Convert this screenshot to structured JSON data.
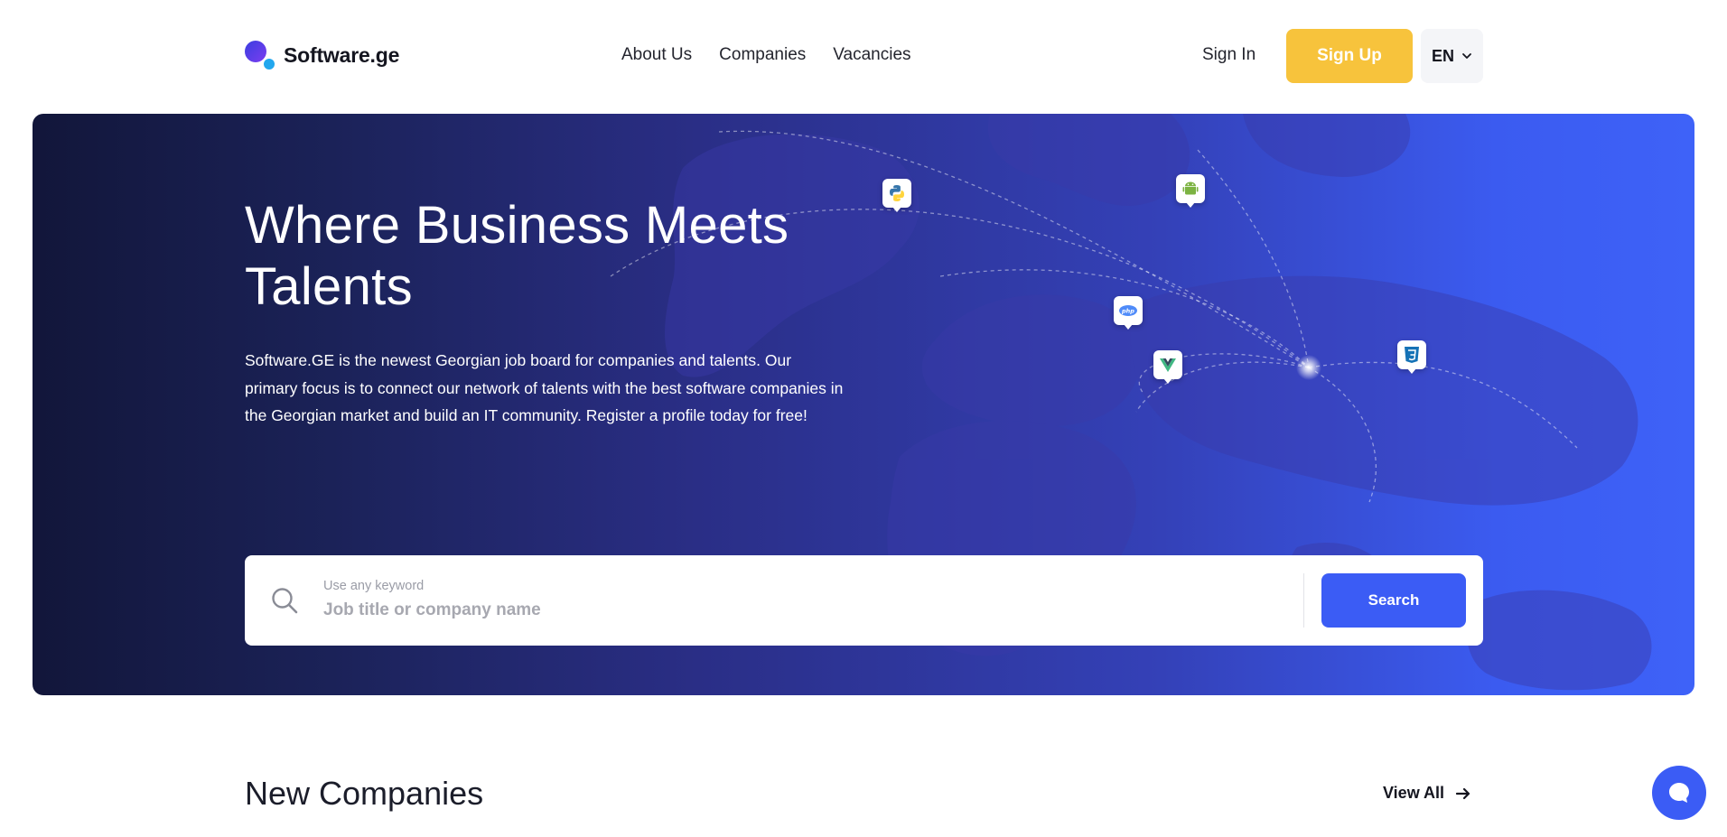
{
  "brand": {
    "name": "Software.ge"
  },
  "nav": {
    "items": [
      {
        "label": "About Us"
      },
      {
        "label": "Companies"
      },
      {
        "label": "Vacancies"
      }
    ]
  },
  "auth": {
    "signin_label": "Sign In",
    "signup_label": "Sign Up"
  },
  "language": {
    "selected": "EN"
  },
  "hero": {
    "title": "Where Business Meets Talents",
    "description": "Software.GE is the newest Georgian job board for companies and talents. Our primary focus is to connect our network of talents with the best software companies in the Georgian market and build an IT community. Register a profile today for free!",
    "tech_icons": [
      "python-icon",
      "android-icon",
      "php-icon",
      "vue-icon",
      "css3-icon"
    ]
  },
  "search": {
    "hint": "Use any keyword",
    "placeholder": "Job title or company name",
    "value": "",
    "button_label": "Search"
  },
  "new_companies": {
    "title": "New Companies",
    "view_all_label": "View All"
  },
  "colors": {
    "accent": "#3b5cf5",
    "signup": "#f7c33c",
    "hero_start": "#12163a",
    "hero_end": "#3e62f8"
  }
}
